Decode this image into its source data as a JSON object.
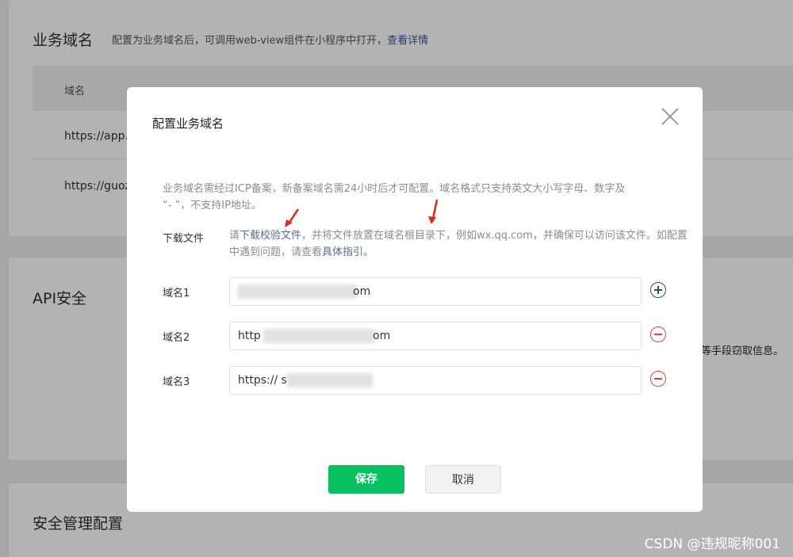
{
  "background": {
    "section1": {
      "title": "业务域名",
      "desc": "配置为业务域名后，可调用web-view组件在小程序中打开，",
      "link": "查看详情"
    },
    "table": {
      "header": "域名",
      "rows": [
        "https://app.",
        "https://guoz"
      ]
    },
    "section2": {
      "title": "API安全",
      "side_text": "等手段窃取信息。"
    },
    "section3": {
      "title": "安全管理配置"
    }
  },
  "modal": {
    "title": "配置业务域名",
    "notice_line1": "业务域名需经过ICP备案，新备案域名需24小时后才可配置。域名格式只支持英文大小写字母、数字及",
    "notice_line2": "“- ”，不支持IP地址。",
    "download": {
      "label": "下载文件",
      "prefix": "请",
      "link": "下载校验文件",
      "middle": "，并将文件放置在域名根目录下，例如wx.qq.com，并确保可以访问该文件。如配置中遇到问题，请查看",
      "guide_link": "具体指引",
      "suffix": "。"
    },
    "domains": [
      {
        "label": "域名1",
        "value": "om",
        "action": "add"
      },
      {
        "label": "域名2",
        "value": "http",
        "value_end": "om",
        "action": "remove"
      },
      {
        "label": "域名3",
        "value": "https:// s",
        "action": "remove"
      }
    ],
    "save_label": "保存",
    "cancel_label": "取消"
  },
  "watermark": "CSDN @违规昵称001",
  "colors": {
    "primary": "#07c160",
    "link": "#576b95",
    "danger": "#e64340",
    "arrow": "#e8261e"
  }
}
